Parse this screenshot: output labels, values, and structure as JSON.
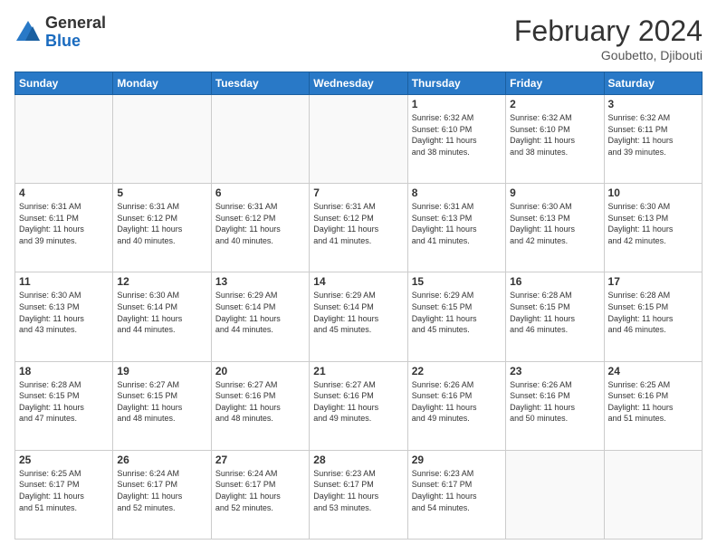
{
  "header": {
    "logo": {
      "general": "General",
      "blue": "Blue"
    },
    "title": "February 2024",
    "location": "Goubetto, Djibouti"
  },
  "weekdays": [
    "Sunday",
    "Monday",
    "Tuesday",
    "Wednesday",
    "Thursday",
    "Friday",
    "Saturday"
  ],
  "weeks": [
    [
      {
        "day": "",
        "info": ""
      },
      {
        "day": "",
        "info": ""
      },
      {
        "day": "",
        "info": ""
      },
      {
        "day": "",
        "info": ""
      },
      {
        "day": "1",
        "info": "Sunrise: 6:32 AM\nSunset: 6:10 PM\nDaylight: 11 hours\nand 38 minutes."
      },
      {
        "day": "2",
        "info": "Sunrise: 6:32 AM\nSunset: 6:10 PM\nDaylight: 11 hours\nand 38 minutes."
      },
      {
        "day": "3",
        "info": "Sunrise: 6:32 AM\nSunset: 6:11 PM\nDaylight: 11 hours\nand 39 minutes."
      }
    ],
    [
      {
        "day": "4",
        "info": "Sunrise: 6:31 AM\nSunset: 6:11 PM\nDaylight: 11 hours\nand 39 minutes."
      },
      {
        "day": "5",
        "info": "Sunrise: 6:31 AM\nSunset: 6:12 PM\nDaylight: 11 hours\nand 40 minutes."
      },
      {
        "day": "6",
        "info": "Sunrise: 6:31 AM\nSunset: 6:12 PM\nDaylight: 11 hours\nand 40 minutes."
      },
      {
        "day": "7",
        "info": "Sunrise: 6:31 AM\nSunset: 6:12 PM\nDaylight: 11 hours\nand 41 minutes."
      },
      {
        "day": "8",
        "info": "Sunrise: 6:31 AM\nSunset: 6:13 PM\nDaylight: 11 hours\nand 41 minutes."
      },
      {
        "day": "9",
        "info": "Sunrise: 6:30 AM\nSunset: 6:13 PM\nDaylight: 11 hours\nand 42 minutes."
      },
      {
        "day": "10",
        "info": "Sunrise: 6:30 AM\nSunset: 6:13 PM\nDaylight: 11 hours\nand 42 minutes."
      }
    ],
    [
      {
        "day": "11",
        "info": "Sunrise: 6:30 AM\nSunset: 6:13 PM\nDaylight: 11 hours\nand 43 minutes."
      },
      {
        "day": "12",
        "info": "Sunrise: 6:30 AM\nSunset: 6:14 PM\nDaylight: 11 hours\nand 44 minutes."
      },
      {
        "day": "13",
        "info": "Sunrise: 6:29 AM\nSunset: 6:14 PM\nDaylight: 11 hours\nand 44 minutes."
      },
      {
        "day": "14",
        "info": "Sunrise: 6:29 AM\nSunset: 6:14 PM\nDaylight: 11 hours\nand 45 minutes."
      },
      {
        "day": "15",
        "info": "Sunrise: 6:29 AM\nSunset: 6:15 PM\nDaylight: 11 hours\nand 45 minutes."
      },
      {
        "day": "16",
        "info": "Sunrise: 6:28 AM\nSunset: 6:15 PM\nDaylight: 11 hours\nand 46 minutes."
      },
      {
        "day": "17",
        "info": "Sunrise: 6:28 AM\nSunset: 6:15 PM\nDaylight: 11 hours\nand 46 minutes."
      }
    ],
    [
      {
        "day": "18",
        "info": "Sunrise: 6:28 AM\nSunset: 6:15 PM\nDaylight: 11 hours\nand 47 minutes."
      },
      {
        "day": "19",
        "info": "Sunrise: 6:27 AM\nSunset: 6:15 PM\nDaylight: 11 hours\nand 48 minutes."
      },
      {
        "day": "20",
        "info": "Sunrise: 6:27 AM\nSunset: 6:16 PM\nDaylight: 11 hours\nand 48 minutes."
      },
      {
        "day": "21",
        "info": "Sunrise: 6:27 AM\nSunset: 6:16 PM\nDaylight: 11 hours\nand 49 minutes."
      },
      {
        "day": "22",
        "info": "Sunrise: 6:26 AM\nSunset: 6:16 PM\nDaylight: 11 hours\nand 49 minutes."
      },
      {
        "day": "23",
        "info": "Sunrise: 6:26 AM\nSunset: 6:16 PM\nDaylight: 11 hours\nand 50 minutes."
      },
      {
        "day": "24",
        "info": "Sunrise: 6:25 AM\nSunset: 6:16 PM\nDaylight: 11 hours\nand 51 minutes."
      }
    ],
    [
      {
        "day": "25",
        "info": "Sunrise: 6:25 AM\nSunset: 6:17 PM\nDaylight: 11 hours\nand 51 minutes."
      },
      {
        "day": "26",
        "info": "Sunrise: 6:24 AM\nSunset: 6:17 PM\nDaylight: 11 hours\nand 52 minutes."
      },
      {
        "day": "27",
        "info": "Sunrise: 6:24 AM\nSunset: 6:17 PM\nDaylight: 11 hours\nand 52 minutes."
      },
      {
        "day": "28",
        "info": "Sunrise: 6:23 AM\nSunset: 6:17 PM\nDaylight: 11 hours\nand 53 minutes."
      },
      {
        "day": "29",
        "info": "Sunrise: 6:23 AM\nSunset: 6:17 PM\nDaylight: 11 hours\nand 54 minutes."
      },
      {
        "day": "",
        "info": ""
      },
      {
        "day": "",
        "info": ""
      }
    ]
  ]
}
